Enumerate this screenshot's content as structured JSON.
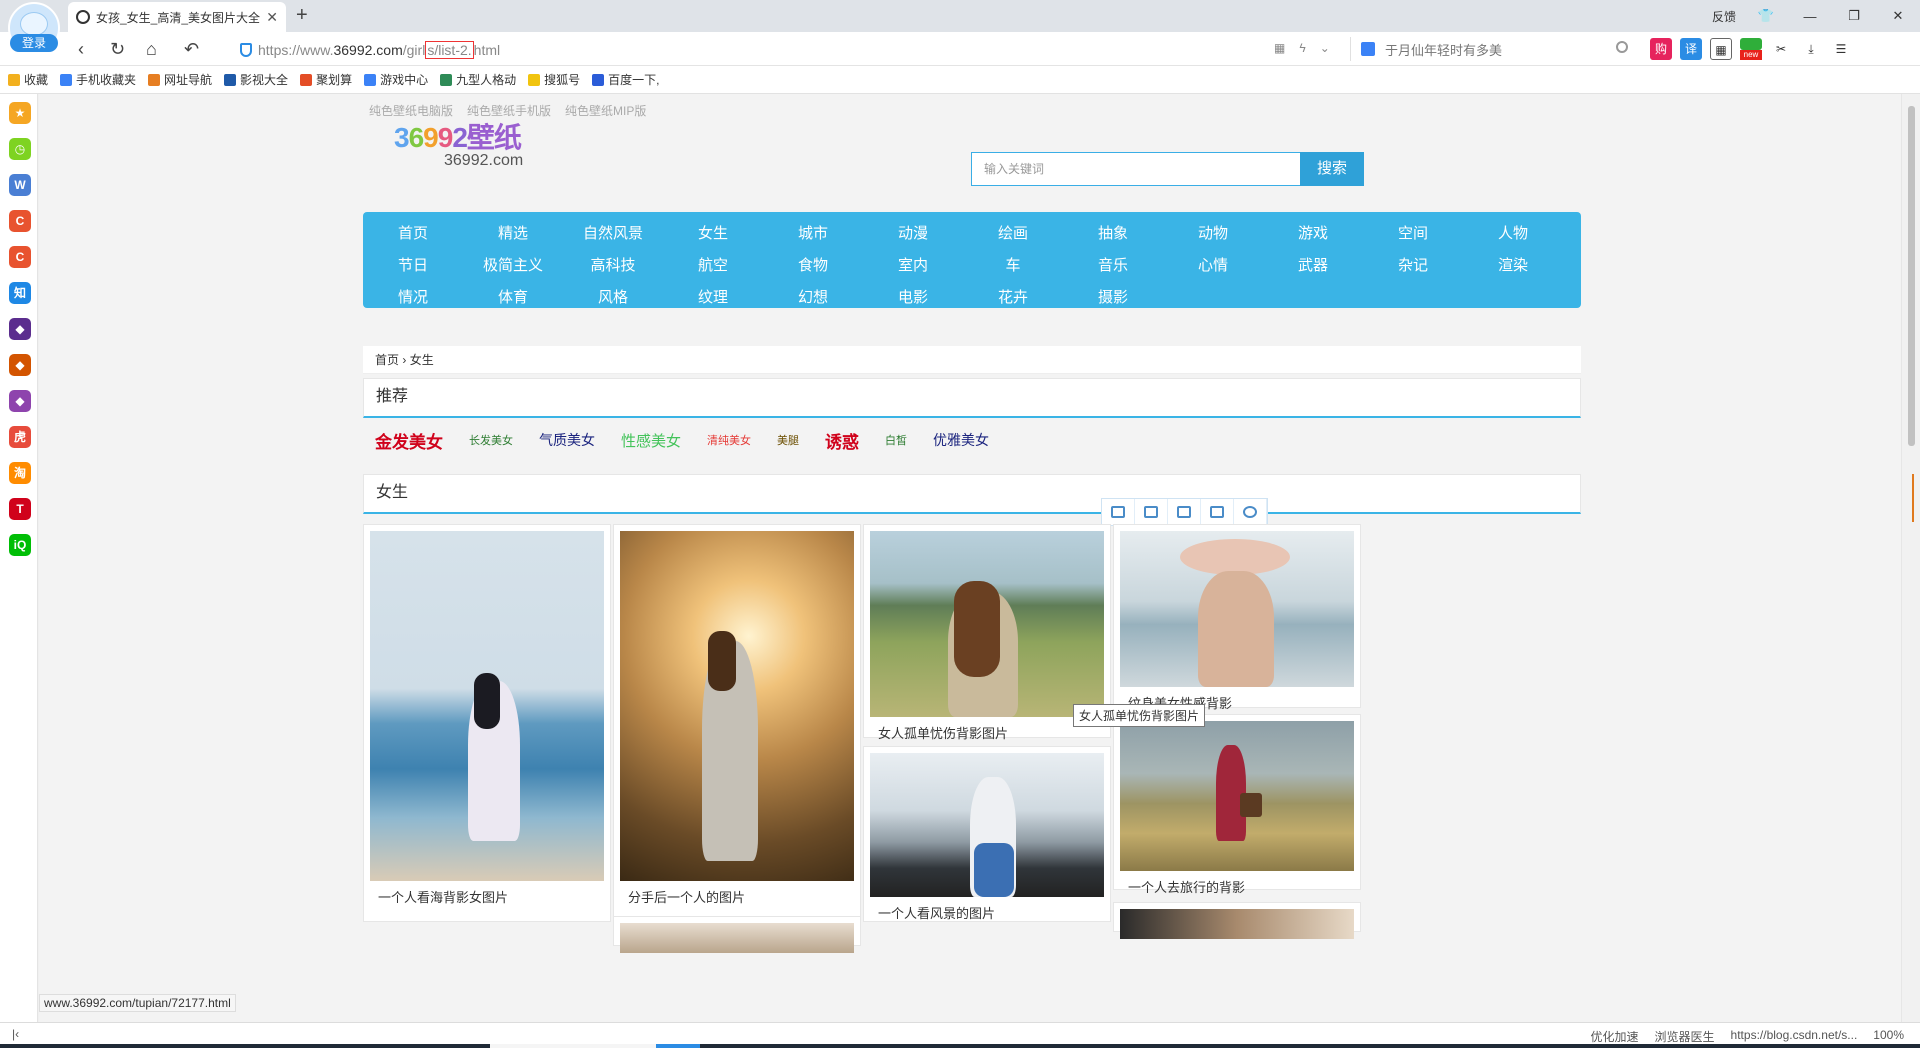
{
  "browser": {
    "login_label": "登录",
    "tab_title": "女孩_女生_高清_美女图片大全",
    "feedback": "反馈",
    "url_prefix": "https://www.36992.com/girl",
    "url_domain": "36992.com",
    "url_path_before": "/girl",
    "url_highlight": "s/list-2.",
    "url_suffix": "html",
    "url_scheme": "https://www.",
    "search_placeholder": "于月仙年轻时有多美",
    "new_badge": "new",
    "translate_label": "译",
    "shop_label": "购"
  },
  "bookmarks": [
    {
      "label": "收藏",
      "color": "#f2b01e"
    },
    {
      "label": "手机收藏夹",
      "color": "#3b82f6"
    },
    {
      "label": "网址导航",
      "color": "#e67e22"
    },
    {
      "label": "影视大全",
      "color": "#1f5aa8"
    },
    {
      "label": "聚划算",
      "color": "#e44d26"
    },
    {
      "label": "游戏中心",
      "color": "#3b82f6"
    },
    {
      "label": "九型人格动",
      "color": "#2e8b57"
    },
    {
      "label": "搜狐号",
      "color": "#f1c40f"
    },
    {
      "label": "百度一下,",
      "color": "#2b5cd8"
    }
  ],
  "leftbar": [
    {
      "icon": "star-icon",
      "color": "#f5a623",
      "glyph": "★"
    },
    {
      "icon": "clock-icon",
      "color": "#7ed321",
      "glyph": "◷"
    },
    {
      "icon": "word-doc-icon",
      "color": "#4a7fd4",
      "glyph": "W"
    },
    {
      "icon": "c-app-icon",
      "color": "#e8532f",
      "glyph": "C"
    },
    {
      "icon": "c-app-icon-2",
      "color": "#e8532f",
      "glyph": "C"
    },
    {
      "icon": "zhihu-icon",
      "color": "#1e88e5",
      "glyph": "知"
    },
    {
      "icon": "game-icon",
      "color": "#5b2d8e",
      "glyph": "◆"
    },
    {
      "icon": "game-icon-2",
      "color": "#d35400",
      "glyph": "◆"
    },
    {
      "icon": "game-icon-3",
      "color": "#8e44ad",
      "glyph": "◆"
    },
    {
      "icon": "huya-icon",
      "color": "#e74c3c",
      "glyph": "虎"
    },
    {
      "icon": "taobao-icon",
      "color": "#ff8c00",
      "glyph": "淘"
    },
    {
      "icon": "tmall-icon",
      "color": "#d0021b",
      "glyph": "T"
    },
    {
      "icon": "iqiyi-icon",
      "color": "#00be06",
      "glyph": "iQ"
    }
  ],
  "site": {
    "top_links": [
      "纯色壁纸电脑版",
      "纯色壁纸手机版",
      "纯色壁纸MIP版"
    ],
    "logo_digits": [
      "3",
      "6",
      "9",
      "9",
      "2"
    ],
    "logo_text": "壁纸",
    "logo_domain": "36992.com",
    "search_placeholder": "输入关键词",
    "search_button": "搜索",
    "nav_rows": [
      [
        "首页",
        "精选",
        "自然风景",
        "女生",
        "城市",
        "动漫",
        "绘画",
        "抽象",
        "动物",
        "游戏",
        "空间",
        "人物"
      ],
      [
        "节日",
        "极简主义",
        "高科技",
        "航空",
        "食物",
        "室内",
        "车",
        "音乐",
        "心情",
        "武器",
        "杂记",
        "渲染"
      ],
      [
        "情况",
        "体育",
        "风格",
        "纹理",
        "幻想",
        "电影",
        "花卉",
        "摄影"
      ]
    ],
    "breadcrumb": [
      "首页",
      "女生"
    ],
    "breadcrumb_sep": "›",
    "recommend_title": "推荐",
    "tags": [
      {
        "label": "金发美女",
        "color": "#d0021b",
        "size": 17,
        "bold": true
      },
      {
        "label": "长发美女",
        "color": "#2e7d32",
        "size": 11,
        "bold": false
      },
      {
        "label": "气质美女",
        "color": "#1a237e",
        "size": 14,
        "bold": false
      },
      {
        "label": "性感美女",
        "color": "#43c35a",
        "size": 15,
        "bold": false
      },
      {
        "label": "清纯美女",
        "color": "#e53935",
        "size": 11,
        "bold": false
      },
      {
        "label": "美腿",
        "color": "#6b4e00",
        "size": 11,
        "bold": false
      },
      {
        "label": "诱惑",
        "color": "#d0021b",
        "size": 17,
        "bold": true
      },
      {
        "label": "白皙",
        "color": "#2e7d32",
        "size": 11,
        "bold": false
      },
      {
        "label": "优雅美女",
        "color": "#1a237e",
        "size": 14,
        "bold": false
      }
    ],
    "section_title": "女生",
    "tooltip": "女人孤单忧伤背影图片",
    "cards": [
      {
        "caption": "一个人看海背影女图片"
      },
      {
        "caption": "分手后一个人的图片"
      },
      {
        "caption": "女人孤单忧伤背影图片"
      },
      {
        "caption": "纹身美女性感背影"
      },
      {
        "caption": "一个人看风景的图片"
      },
      {
        "caption": "一个人去旅行的背影"
      }
    ]
  },
  "status": {
    "hover_url": "www.36992.com/tupian/72177.html",
    "items": [
      "优化加速",
      "浏览器医生",
      "https://blog.csdn.net/s...",
      "100%"
    ]
  }
}
